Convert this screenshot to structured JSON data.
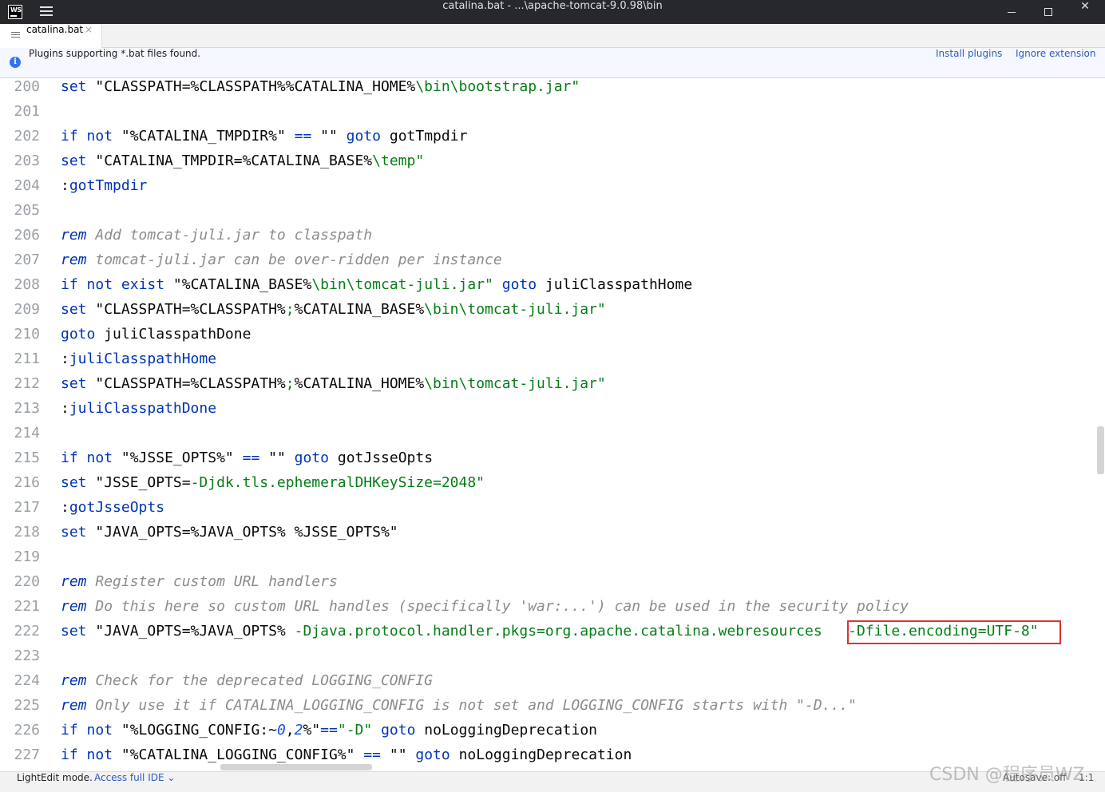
{
  "window": {
    "logo_text": "WS",
    "title": "catalina.bat - ...\\apache-tomcat-9.0.98\\bin",
    "close_glyph": "✕"
  },
  "tab": {
    "label": "catalina.bat",
    "close_glyph": "×"
  },
  "banner": {
    "icon_glyph": "i",
    "message": "Plugins supporting *.bat files found.",
    "install_link": "Install plugins",
    "ignore_link": "Ignore extension"
  },
  "editor": {
    "lines": [
      {
        "no": "200",
        "tokens": [
          [
            "kw",
            "set"
          ],
          [
            "t",
            " \"CLASSPATH=%CLASSPATH%%CATALINA_HOME%"
          ],
          [
            "str",
            "\\bin\\bootstrap.jar\""
          ]
        ]
      },
      {
        "no": "201",
        "tokens": []
      },
      {
        "no": "202",
        "tokens": [
          [
            "kw",
            "if"
          ],
          [
            "t",
            " "
          ],
          [
            "kw",
            "not"
          ],
          [
            "t",
            " \"%CATALINA_TMPDIR%\" "
          ],
          [
            "kw",
            "=="
          ],
          [
            "t",
            " \"\" "
          ],
          [
            "kw",
            "goto"
          ],
          [
            "t",
            " gotTmpdir"
          ]
        ]
      },
      {
        "no": "203",
        "tokens": [
          [
            "kw",
            "set"
          ],
          [
            "t",
            " \"CATALINA_TMPDIR=%CATALINA_BASE%"
          ],
          [
            "str",
            "\\temp\""
          ]
        ]
      },
      {
        "no": "204",
        "tokens": [
          [
            "t",
            ":"
          ],
          [
            "kw",
            "gotTmpdir"
          ]
        ]
      },
      {
        "no": "205",
        "tokens": []
      },
      {
        "no": "206",
        "tokens": [
          [
            "kwi",
            "rem"
          ],
          [
            "com",
            " Add tomcat-juli.jar to classpath"
          ]
        ]
      },
      {
        "no": "207",
        "tokens": [
          [
            "kwi",
            "rem"
          ],
          [
            "com",
            " tomcat-juli.jar can be over-ridden per instance"
          ]
        ]
      },
      {
        "no": "208",
        "tokens": [
          [
            "kw",
            "if"
          ],
          [
            "t",
            " "
          ],
          [
            "kw",
            "not"
          ],
          [
            "t",
            " "
          ],
          [
            "kw",
            "exist"
          ],
          [
            "t",
            " \"%CATALINA_BASE%"
          ],
          [
            "str",
            "\\bin\\tomcat-juli.jar\""
          ],
          [
            "t",
            " "
          ],
          [
            "kw",
            "goto"
          ],
          [
            "t",
            " juliClasspathHome"
          ]
        ]
      },
      {
        "no": "209",
        "tokens": [
          [
            "kw",
            "set"
          ],
          [
            "t",
            " \"CLASSPATH=%CLASSPATH%"
          ],
          [
            "str",
            ";"
          ],
          [
            "t",
            "%CATALINA_BASE%"
          ],
          [
            "str",
            "\\bin\\tomcat-juli.jar\""
          ]
        ]
      },
      {
        "no": "210",
        "tokens": [
          [
            "kw",
            "goto"
          ],
          [
            "t",
            " juliClasspathDone"
          ]
        ]
      },
      {
        "no": "211",
        "tokens": [
          [
            "t",
            ":"
          ],
          [
            "kw",
            "juliClasspathHome"
          ]
        ]
      },
      {
        "no": "212",
        "tokens": [
          [
            "kw",
            "set"
          ],
          [
            "t",
            " \"CLASSPATH=%CLASSPATH%"
          ],
          [
            "str",
            ";"
          ],
          [
            "t",
            "%CATALINA_HOME%"
          ],
          [
            "str",
            "\\bin\\tomcat-juli.jar\""
          ]
        ]
      },
      {
        "no": "213",
        "tokens": [
          [
            "t",
            ":"
          ],
          [
            "kw",
            "juliClasspathDone"
          ]
        ]
      },
      {
        "no": "214",
        "tokens": []
      },
      {
        "no": "215",
        "tokens": [
          [
            "kw",
            "if"
          ],
          [
            "t",
            " "
          ],
          [
            "kw",
            "not"
          ],
          [
            "t",
            " \"%JSSE_OPTS%\" "
          ],
          [
            "kw",
            "=="
          ],
          [
            "t",
            " \"\" "
          ],
          [
            "kw",
            "goto"
          ],
          [
            "t",
            " gotJsseOpts"
          ]
        ]
      },
      {
        "no": "216",
        "tokens": [
          [
            "kw",
            "set"
          ],
          [
            "t",
            " \"JSSE_OPTS="
          ],
          [
            "str",
            "-Djdk.tls.ephemeralDHKeySize=2048\""
          ]
        ]
      },
      {
        "no": "217",
        "tokens": [
          [
            "t",
            ":"
          ],
          [
            "kw",
            "gotJsseOpts"
          ]
        ]
      },
      {
        "no": "218",
        "tokens": [
          [
            "kw",
            "set"
          ],
          [
            "t",
            " \"JAVA_OPTS=%JAVA_OPTS% %JSSE_OPTS%\""
          ]
        ]
      },
      {
        "no": "219",
        "tokens": []
      },
      {
        "no": "220",
        "tokens": [
          [
            "kwi",
            "rem"
          ],
          [
            "com",
            " Register custom URL handlers"
          ]
        ]
      },
      {
        "no": "221",
        "tokens": [
          [
            "kwi",
            "rem"
          ],
          [
            "com",
            " Do this here so custom URL handles (specifically 'war:...') can be used in the security policy"
          ]
        ]
      },
      {
        "no": "222",
        "tokens": [
          [
            "kw",
            "set"
          ],
          [
            "t",
            " \"JAVA_OPTS=%JAVA_OPTS% "
          ],
          [
            "str",
            "-Djava.protocol.handler.pkgs=org.apache.catalina.webresources   -Dfile.encoding=UTF-8\""
          ]
        ]
      },
      {
        "no": "223",
        "tokens": []
      },
      {
        "no": "224",
        "tokens": [
          [
            "kwi",
            "rem"
          ],
          [
            "com",
            " Check for the deprecated LOGGING_CONFIG"
          ]
        ]
      },
      {
        "no": "225",
        "tokens": [
          [
            "kwi",
            "rem"
          ],
          [
            "com",
            " Only use it if CATALINA_LOGGING_CONFIG is not set and LOGGING_CONFIG starts with \"-D...\""
          ]
        ]
      },
      {
        "no": "226",
        "tokens": [
          [
            "kw",
            "if"
          ],
          [
            "t",
            " "
          ],
          [
            "kw",
            "not"
          ],
          [
            "t",
            " \"%LOGGING_CONFIG:~"
          ],
          [
            "num",
            "0"
          ],
          [
            "t",
            ","
          ],
          [
            "num",
            "2"
          ],
          [
            "t",
            "%\""
          ],
          [
            "kw",
            "=="
          ],
          [
            "str",
            "\"-D\""
          ],
          [
            "t",
            " "
          ],
          [
            "kw",
            "goto"
          ],
          [
            "t",
            " noLoggingDeprecation"
          ]
        ]
      },
      {
        "no": "227",
        "tokens": [
          [
            "kw",
            "if"
          ],
          [
            "t",
            " "
          ],
          [
            "kw",
            "not"
          ],
          [
            "t",
            " \"%CATALINA_LOGGING_CONFIG%\" "
          ],
          [
            "kw",
            "=="
          ],
          [
            "t",
            " \"\" "
          ],
          [
            "kw",
            "goto"
          ],
          [
            "t",
            " noLoggingDeprecation"
          ]
        ]
      }
    ]
  },
  "status": {
    "mode": "LightEdit mode.",
    "access_link": "Access full IDE ⌄",
    "autosave": "Autosave: off",
    "position": "1:1"
  },
  "watermark": "CSDN @程序员WZ"
}
